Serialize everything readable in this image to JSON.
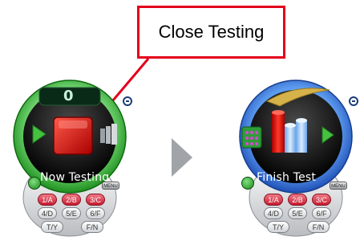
{
  "callout": {
    "label": "Close Testing"
  },
  "left_device": {
    "status_text": "Now Testing",
    "counter_digit": "0",
    "menu_label": "MENU",
    "keys": [
      "1/A",
      "2/B",
      "3/C",
      "4/D",
      "5/E",
      "6/F",
      "T/Y",
      "F/N"
    ]
  },
  "right_device": {
    "status_text": "Finish Test",
    "menu_label": "MENU",
    "keys": [
      "1/A",
      "2/B",
      "3/C",
      "4/D",
      "5/E",
      "6/F",
      "T/Y",
      "F/N"
    ]
  },
  "colors": {
    "callout_border": "#e3001b",
    "left_ring": "#3bb03b",
    "right_ring": "#2f6fd6",
    "stop_button": "#e01414",
    "arrow_between": "#a0a4a8"
  }
}
